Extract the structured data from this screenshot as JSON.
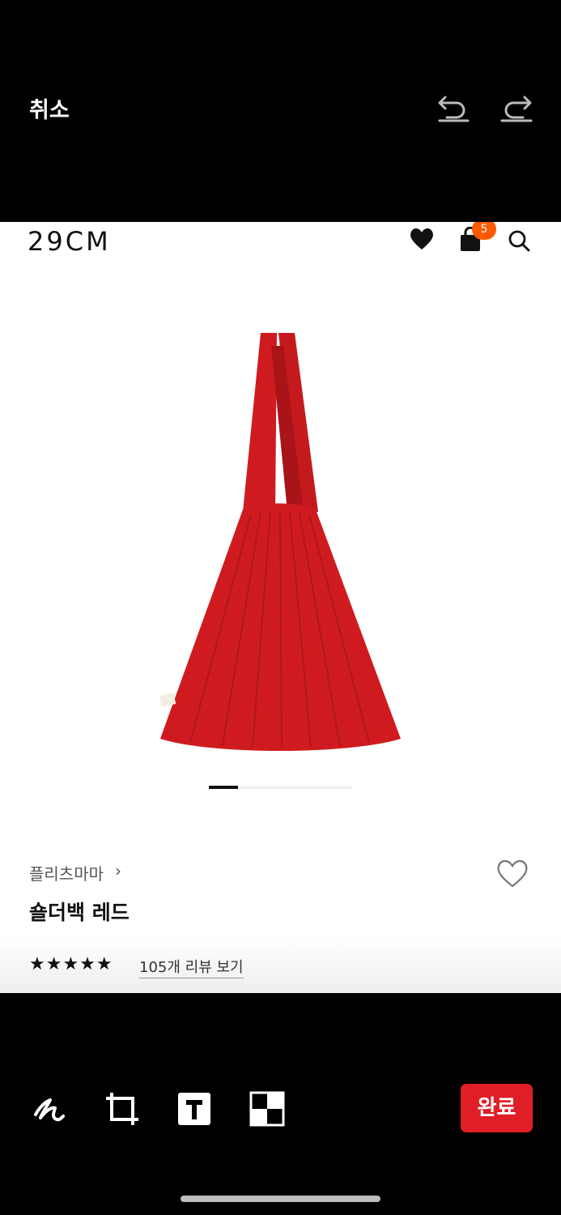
{
  "editor": {
    "cancel_label": "취소",
    "done_label": "완료",
    "tools": [
      "pen-icon",
      "crop-icon",
      "text-icon",
      "mosaic-icon"
    ]
  },
  "screenshot": {
    "logo": "29CM",
    "cart_count": "5",
    "brand_name": "플리츠마마",
    "brand_chevron": "›",
    "product_name": "숄더백 레드",
    "rating_stars": "★★★★★",
    "review_link": "105개 리뷰 보기",
    "carousel": {
      "total_slides": 5,
      "active_index": 0
    },
    "colors": {
      "accent": "#e01e26",
      "cart_badge": "#ff5a00",
      "product": "#cf1b1f"
    }
  }
}
